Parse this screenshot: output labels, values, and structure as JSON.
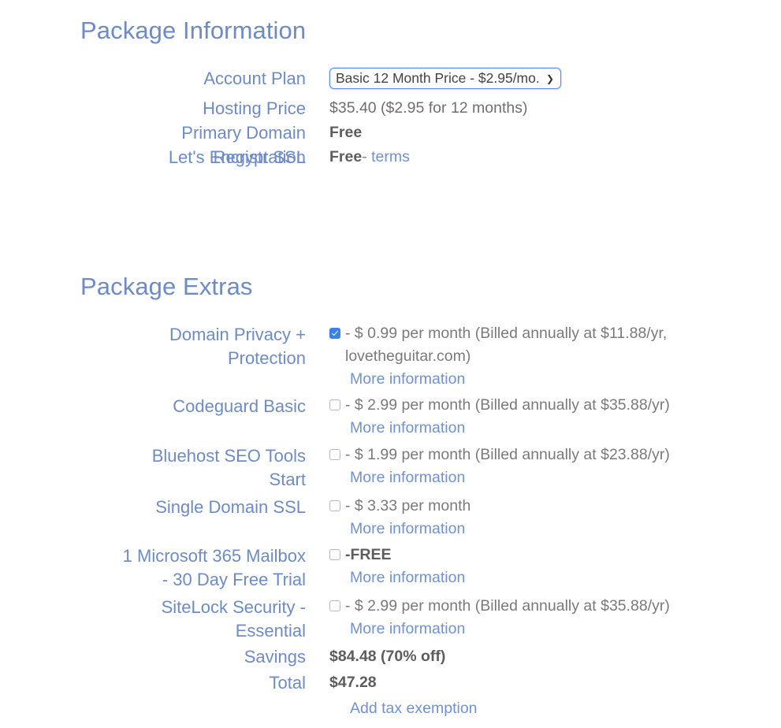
{
  "package_information": {
    "title": "Package Information",
    "account_plan": {
      "label": "Account Plan",
      "selected": "Basic 12 Month Price - $2.95/mo.",
      "caret_icon": "chevron-down-icon",
      "options": [
        "Basic 12 Month Price - $2.95/mo."
      ]
    },
    "hosting_price": {
      "label": "Hosting Price",
      "value": "$35.40  ($2.95 for 12 months)"
    },
    "primary_domain": {
      "label": "Primary Domain\nRegistration",
      "value": "Free"
    },
    "lets_encrypt_ssl": {
      "label": "Let's Encrypt SSL",
      "value": "Free",
      "separator": "-",
      "terms_link": "terms"
    }
  },
  "package_extras": {
    "title": "Package Extras",
    "more_information_label": "More information",
    "items": [
      {
        "label": "Domain Privacy +\nProtection",
        "checked": true,
        "price_text": "- $ 0.99 per month (Billed annually at $11.88/yr, lovetheguitar.com)",
        "bold": false,
        "more_information": "More information"
      },
      {
        "label": "Codeguard Basic",
        "checked": false,
        "price_text": "- $ 2.99 per month (Billed annually at $35.88/yr)",
        "bold": false,
        "more_information": "More information"
      },
      {
        "label": "Bluehost SEO Tools\nStart",
        "checked": false,
        "price_text": "- $ 1.99 per month (Billed annually at $23.88/yr)",
        "bold": false,
        "more_information": "More information"
      },
      {
        "label": "Single Domain SSL",
        "checked": false,
        "price_text": "- $ 3.33 per month",
        "bold": false,
        "more_information": "More information"
      },
      {
        "label": "1 Microsoft 365 Mailbox\n- 30 Day Free Trial",
        "checked": false,
        "price_text": "-FREE",
        "bold": true,
        "more_information": "More information"
      },
      {
        "label": "SiteLock Security -\nEssential",
        "checked": false,
        "price_text": "- $ 2.99 per month (Billed annually at $35.88/yr)",
        "bold": false,
        "more_information": "More information"
      }
    ],
    "savings": {
      "label": "Savings",
      "value": "$84.48 (70% off)"
    },
    "total": {
      "label": "Total",
      "value": "$47.28"
    },
    "tax_exemption_link": "Add tax exemption"
  },
  "colors": {
    "label_blue": "#6d8cc7",
    "link_blue": "#6f92d6",
    "value_gray": "#7a7a7a",
    "bold_gray": "#5d5d5d",
    "checkbox_checked": "#3b82e8",
    "select_border": "#5b8def",
    "background": "#ffffff"
  }
}
